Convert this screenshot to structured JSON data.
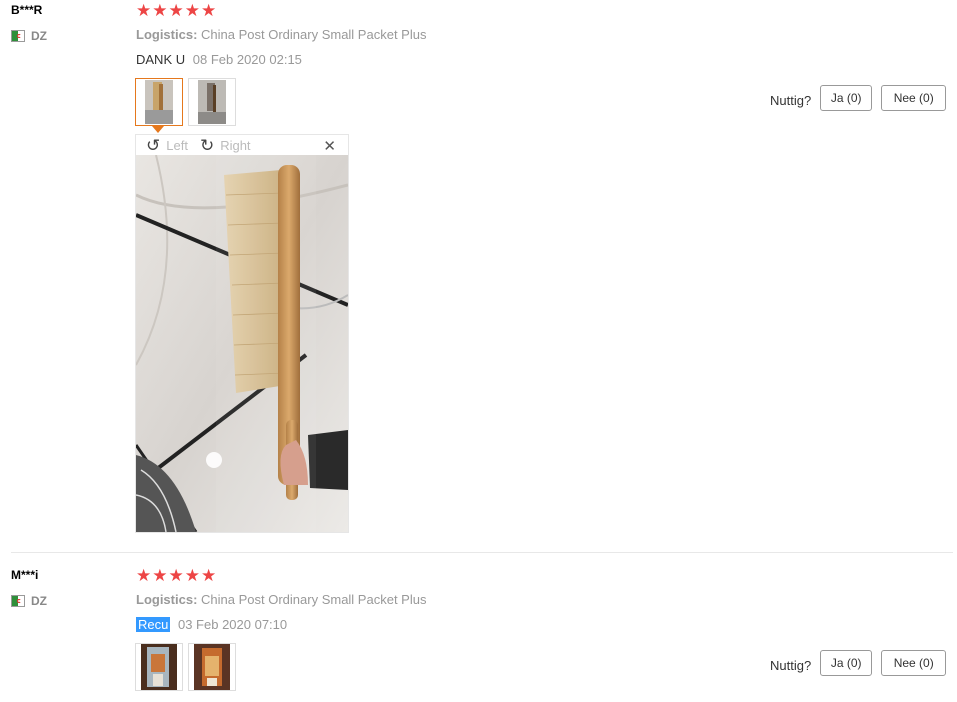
{
  "reviews": [
    {
      "user": "B***R",
      "country": "DZ",
      "stars": "★★★★★",
      "logistics_label": "Logistics:",
      "logistics_value": "China Post Ordinary Small Packet Plus",
      "feedback_text": "DANK U",
      "date": "08 Feb 2020 02:15",
      "helpful_label": "Nuttig?",
      "yes_label": "Ja (0)",
      "no_label": "Nee (0)"
    },
    {
      "user": "M***i",
      "country": "DZ",
      "stars": "★★★★★",
      "logistics_label": "Logistics:",
      "logistics_value": "China Post Ordinary Small Packet Plus",
      "feedback_text": "Recu",
      "date": "03 Feb 2020 07:10",
      "helpful_label": "Nuttig?",
      "yes_label": "Ja (0)",
      "no_label": "Nee (0)"
    }
  ],
  "viewer": {
    "left_label": "Left",
    "right_label": "Right",
    "close_symbol": "✕",
    "rotate_left_symbol": "↺",
    "rotate_right_symbol": "↻"
  },
  "colors": {
    "star": "#ed4545",
    "active_thumb": "#e5781d",
    "highlight": "#3399ff"
  }
}
